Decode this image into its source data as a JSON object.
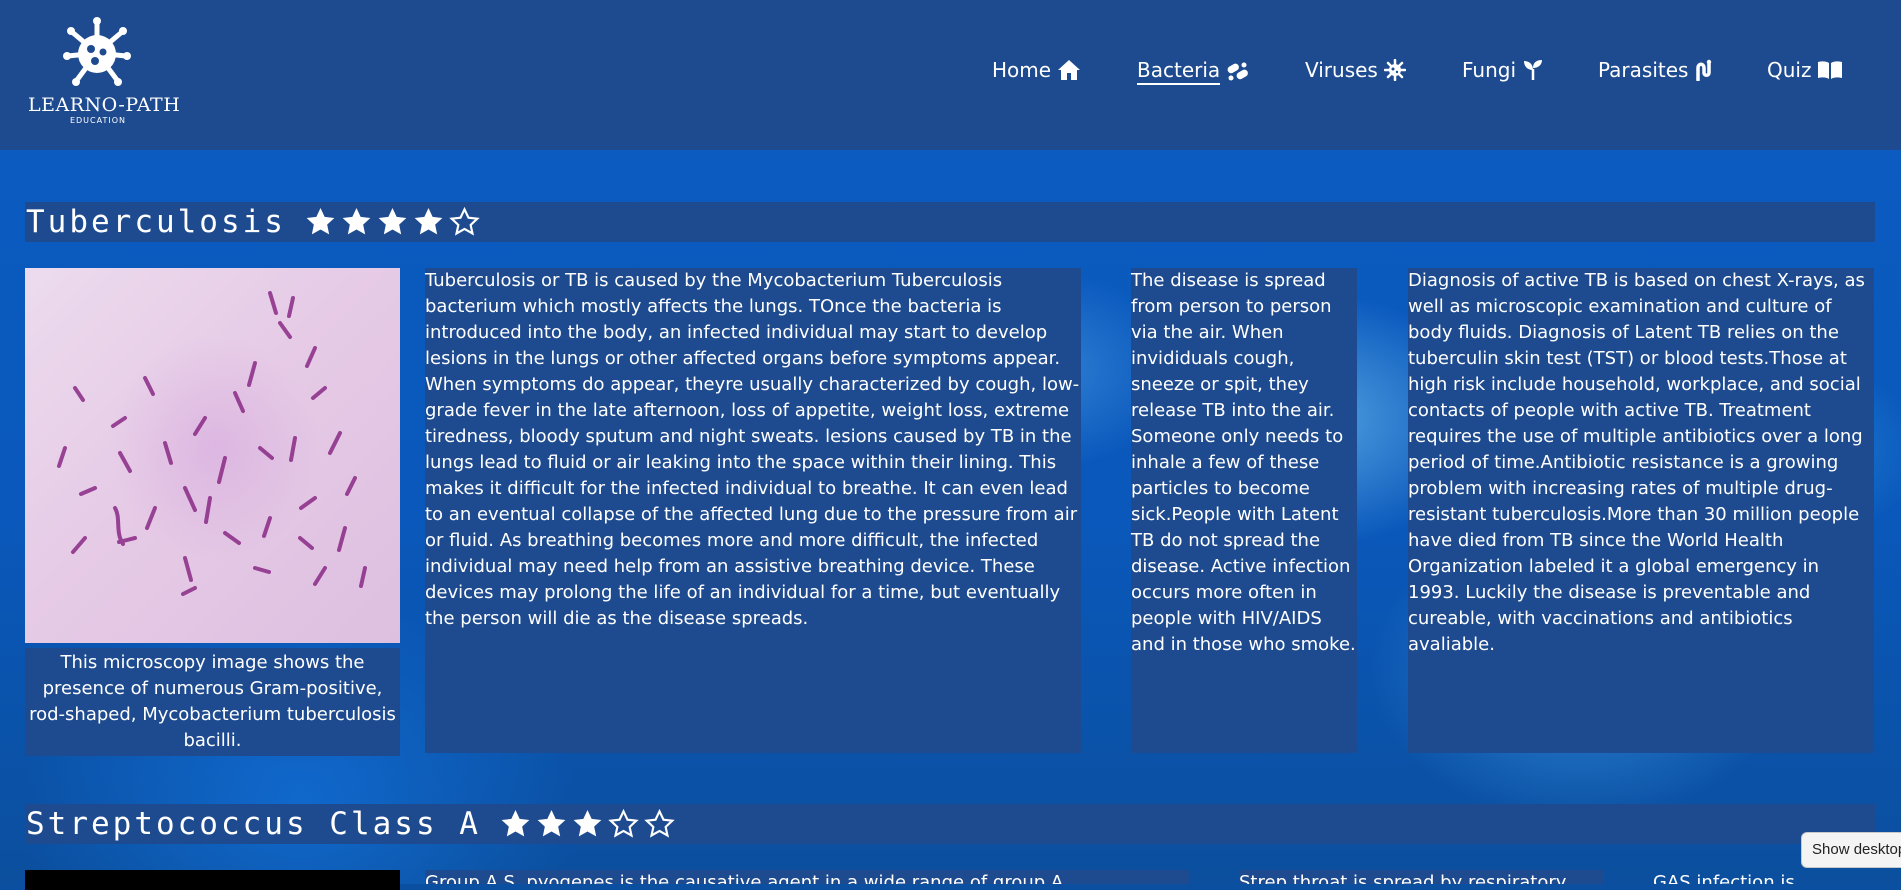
{
  "brand": {
    "name": "LEARNO-PATH",
    "tagline": "EDUCATION"
  },
  "nav": [
    {
      "label": "Home",
      "icon": "home-icon",
      "active": false
    },
    {
      "label": "Bacteria",
      "icon": "bacteria-icon",
      "active": true
    },
    {
      "label": "Viruses",
      "icon": "virus-icon",
      "active": false
    },
    {
      "label": "Fungi",
      "icon": "seedling-icon",
      "active": false
    },
    {
      "label": "Parasites",
      "icon": "worm-icon",
      "active": false
    },
    {
      "label": "Quiz",
      "icon": "book-icon",
      "active": false
    }
  ],
  "sections": [
    {
      "title": "Tuberculosis",
      "rating": 4,
      "rating_max": 5,
      "image_caption": "This microscopy image shows the presence of numerous Gram-positive, rod-shaped, Mycobacterium tuberculosis bacilli.",
      "col1": "Tuberculosis or TB is caused by the Mycobacterium Tuberculosis bacterium which mostly affects the lungs. TOnce the bacteria is introduced into the body, an infected individual may start to develop lesions in the lungs or other affected organs before symptoms appear. When symptoms do appear, theyre usually characterized by cough, low-grade fever in the late afternoon, loss of appetite, weight loss, extreme tiredness, bloody sputum and night sweats. lesions caused by TB in the lungs lead to fluid or air leaking into the space within their lining. This makes it difficult for the infected individual to breathe. It can even lead to an eventual collapse of the affected lung due to the pressure from air or fluid. As breathing becomes more and more difficult, the infected individual may need help from an assistive breathing device. These devices may prolong the life of an individual for a time, but eventually the person will die as the disease spreads.",
      "col2": "The disease is spread from person to person via the air. When invididuals cough, sneeze or spit, they release TB into the air. Someone only needs to inhale a few of these particles to become sick.People with Latent TB do not spread the disease. Active infection occurs more often in people with HIV/AIDS and in those who smoke.",
      "col3": "Diagnosis of active TB is based on chest X-rays, as well as microscopic examination and culture of body fluids. Diagnosis of Latent TB relies on the tuberculin skin test (TST) or blood tests.Those at high risk include household, workplace, and social contacts of people with active TB. Treatment requires the use of multiple antibiotics over a long period of time.Antibiotic resistance is a growing problem with increasing rates of multiple drug-resistant tuberculosis.More than 30 million people have died from TB since the World Health Organization labeled it a global emergency in 1993. Luckily the disease is preventable and cureable, with vaccinations and antibiotics avaliable."
    },
    {
      "title": "Streptococcus Class A",
      "rating": 3,
      "rating_max": 5,
      "col1": "Group A S. pyogenes is the causative agent in a wide range of group A",
      "col2": "Strep throat is spread by respiratory",
      "col3": "GAS infection is"
    }
  ],
  "taskbar": {
    "show_desktop": "Show desktop"
  }
}
